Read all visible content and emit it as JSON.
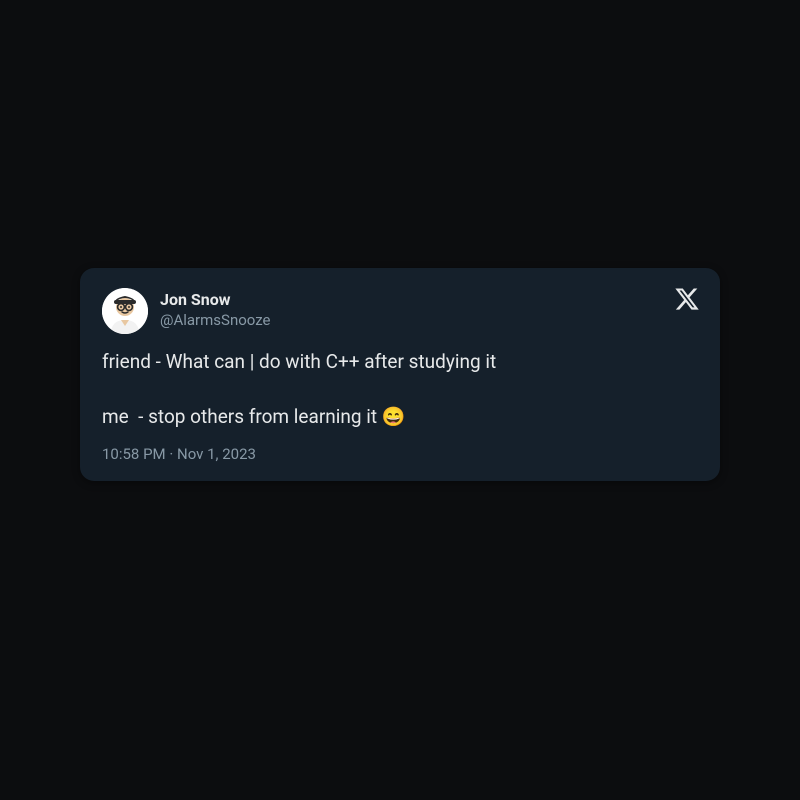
{
  "tweet": {
    "author": {
      "display_name": "Jon Snow",
      "handle": "@AlarmsSnooze"
    },
    "body": "friend - What can | do with C++ after studying it\n\nme  - stop others from learning it 😄",
    "timestamp": "10:58 PM · Nov 1, 2023"
  }
}
